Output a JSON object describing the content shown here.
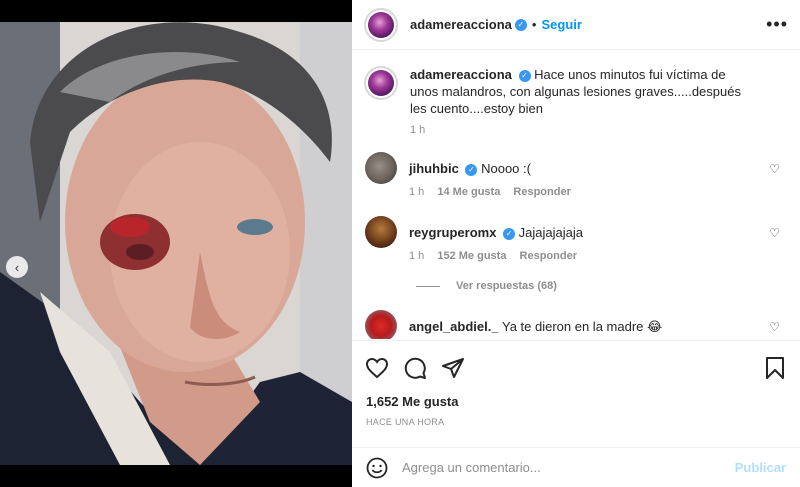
{
  "post": {
    "username": "adamereacciona",
    "follow_label": "Seguir",
    "separator": "•",
    "more_label": "•••",
    "caption": "Hace unos minutos fui víctima de unos malandros, con algunas lesiones graves.....después les cuento....estoy bien",
    "caption_time": "1 h"
  },
  "comments": [
    {
      "username": "jihuhbic",
      "text": "Noooo :(",
      "time": "1 h",
      "likes": "14 Me gusta",
      "reply": "Responder",
      "verified": true
    },
    {
      "username": "reygruperomx",
      "text": "Jajajajajaja",
      "time": "1 h",
      "likes": "152 Me gusta",
      "reply": "Responder",
      "verified": true
    },
    {
      "username": "angel_abdiel._",
      "text": "Ya te dieron en la madre 😂",
      "verified": false
    }
  ],
  "view_replies": "Ver respuestas (68)",
  "likes_count": "1,652 Me gusta",
  "timestamp": "HACE UNA HORA",
  "comment_placeholder": "Agrega un comentario...",
  "publish_label": "Publicar",
  "colors": {
    "accent": "#0095f6",
    "publish_disabled": "#b2dffc",
    "verified": "#3897f0",
    "muted": "#8e8e8e"
  },
  "icons": [
    "carousel-prev-icon",
    "more-options-icon",
    "verified-icon",
    "heart-icon",
    "comment-icon",
    "share-icon",
    "bookmark-icon",
    "emoji-icon"
  ],
  "carousel": {
    "total": 2,
    "current": 2
  }
}
